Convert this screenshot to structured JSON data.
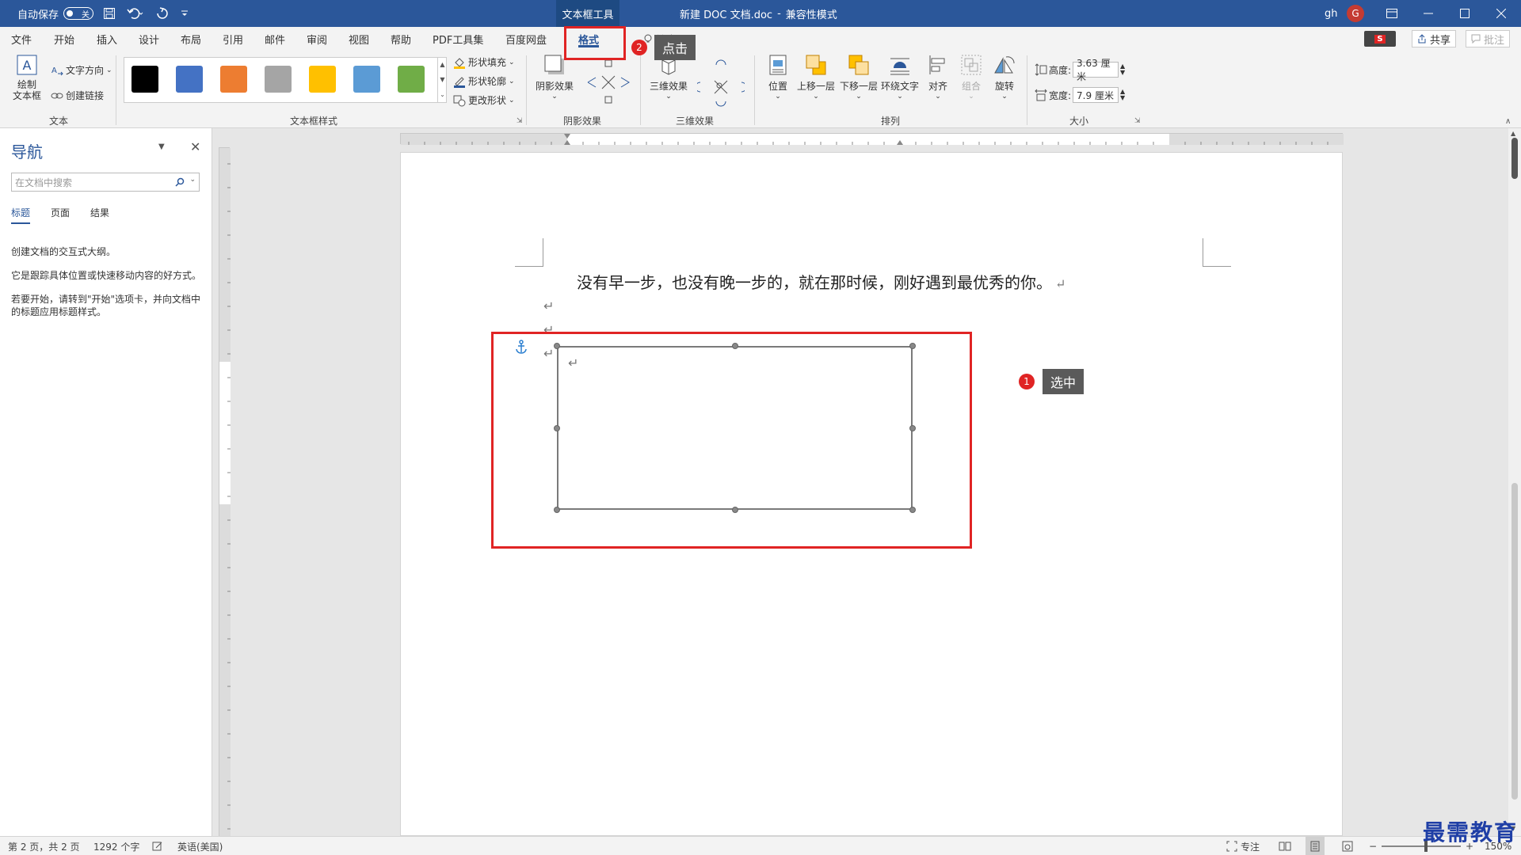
{
  "titlebar": {
    "autosave_label": "自动保存",
    "autosave_state": "关",
    "context_tab": "文本框工具",
    "doc_title": "新建 DOC 文档.doc",
    "mode": "兼容性模式",
    "user": "gh",
    "avatar_letter": "G"
  },
  "menu": {
    "tabs": [
      "文件",
      "开始",
      "插入",
      "设计",
      "布局",
      "引用",
      "邮件",
      "审阅",
      "视图",
      "帮助",
      "PDF工具集",
      "百度网盘",
      "格式"
    ],
    "search_label": "搜索",
    "share_label": "共享",
    "comment_label": "批注"
  },
  "ribbon": {
    "text_group": {
      "label": "文本",
      "draw_textbox": "绘制\n文本框",
      "text_direction": "文字方向",
      "create_link": "创建链接"
    },
    "style_group": {
      "label": "文本框样式",
      "shape_fill": "形状填充",
      "shape_outline": "形状轮廓",
      "change_shape": "更改形状",
      "swatches": [
        "#000000",
        "#4472c4",
        "#ed7d31",
        "#a5a5a5",
        "#ffc000",
        "#5b9bd5",
        "#70ad47"
      ]
    },
    "shadow_group": {
      "label": "阴影效果",
      "shadow_effect": "阴影效果"
    },
    "threed_group": {
      "label": "三维效果",
      "threed_effect": "三维效果"
    },
    "arrange_group": {
      "label": "排列",
      "position": "位置",
      "bring_forward": "上移一层",
      "send_backward": "下移一层",
      "wrap_text": "环绕文字",
      "align": "对齐",
      "group": "组合",
      "rotate": "旋转"
    },
    "size_group": {
      "label": "大小",
      "height_label": "高度:",
      "height_value": "3.63 厘米",
      "width_label": "宽度:",
      "width_value": "7.9 厘米"
    }
  },
  "nav": {
    "title": "导航",
    "search_placeholder": "在文档中搜索",
    "tabs": [
      "标题",
      "页面",
      "结果"
    ],
    "text1": "创建文档的交互式大纲。",
    "text2": "它是跟踪具体位置或快速移动内容的好方式。",
    "text3": "若要开始，请转到\"开始\"选项卡，并向文档中的标题应用标题样式。"
  },
  "document": {
    "line1": "没有早一步，也没有晚一步的，就在那时候，刚好遇到最优秀的你。",
    "para_mark": "↵"
  },
  "callouts": {
    "select": {
      "num": "1",
      "text": "选中"
    },
    "click": {
      "num": "2",
      "text": "点击"
    }
  },
  "status": {
    "page": "第 2 页，共 2 页",
    "words": "1292 个字",
    "language": "英语(美国)",
    "focus": "专注",
    "zoom": "150%"
  },
  "watermark": "最需教育",
  "colors": {
    "brand": "#2b579a",
    "highlight": "#e02424"
  }
}
